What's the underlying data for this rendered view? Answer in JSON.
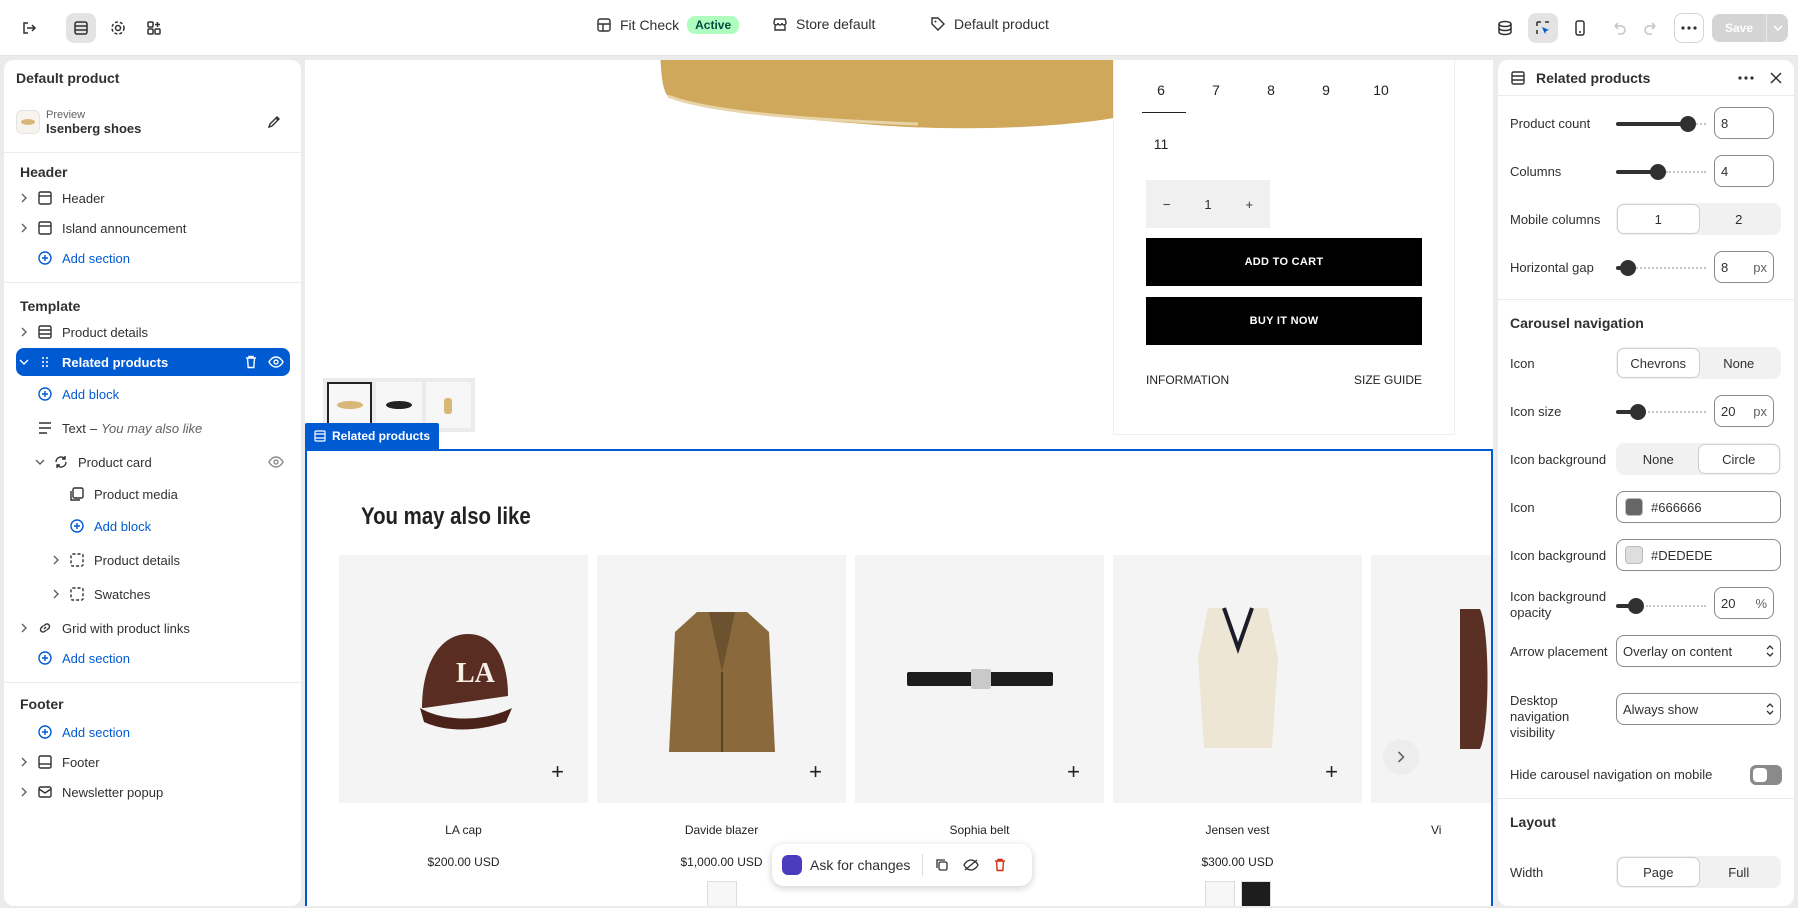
{
  "topbar": {
    "theme_name": "Fit Check",
    "theme_status": "Active",
    "store": "Store default",
    "template": "Default product",
    "save_label": "Save"
  },
  "sidebar": {
    "title": "Default product",
    "preview_label": "Preview",
    "preview_value": "Isenberg shoes",
    "header_group": "Header",
    "header_items": [
      "Header",
      "Island announcement"
    ],
    "add_section": "Add section",
    "template_group": "Template",
    "product_details": "Product details",
    "related_products": "Related products",
    "add_block": "Add block",
    "text_block": "Text",
    "text_block_sep": "–",
    "text_block_value": "You may also like",
    "product_card": "Product card",
    "product_media": "Product media",
    "card_product_details": "Product details",
    "swatches": "Swatches",
    "grid_links": "Grid with product links",
    "footer_group": "Footer",
    "footer": "Footer",
    "newsletter": "Newsletter popup"
  },
  "canvas": {
    "sizes": [
      "6",
      "7",
      "8",
      "9",
      "10",
      "11"
    ],
    "quantity": "1",
    "qty_minus": "−",
    "qty_plus": "+",
    "add_to_cart": "ADD TO CART",
    "buy_now": "BUY IT NOW",
    "information": "INFORMATION",
    "size_guide": "SIZE GUIDE",
    "section_tag": "Related products",
    "heading": "You may also like",
    "card_plus": "+",
    "products": [
      {
        "name": "LA cap",
        "price": "$200.00 USD"
      },
      {
        "name": "Davide blazer",
        "price": "$1,000.00 USD"
      },
      {
        "name": "Sophia belt",
        "price": ""
      },
      {
        "name": "Jensen vest",
        "price": "$300.00 USD"
      },
      {
        "name": "Vi",
        "price": ""
      }
    ],
    "ask_label": "Ask for changes"
  },
  "panel": {
    "title": "Related products",
    "product_count_label": "Product count",
    "product_count": "8",
    "columns_label": "Columns",
    "columns": "4",
    "mobile_columns_label": "Mobile columns",
    "mobile_columns_options": [
      "1",
      "2"
    ],
    "horizontal_gap_label": "Horizontal gap",
    "horizontal_gap": "8",
    "unit_px": "px",
    "carousel_title": "Carousel navigation",
    "icon_label": "Icon",
    "icon_options": [
      "Chevrons",
      "None"
    ],
    "icon_size_label": "Icon size",
    "icon_size": "20",
    "icon_bg_label": "Icon background",
    "icon_bg_options": [
      "None",
      "Circle"
    ],
    "icon_color_label": "Icon",
    "icon_color": "#666666",
    "icon_bg_color_label": "Icon background",
    "icon_bg_color": "#DEDEDE",
    "icon_bg_opacity_label": "Icon background opacity",
    "icon_bg_opacity": "20",
    "unit_pct": "%",
    "arrow_placement_label": "Arrow placement",
    "arrow_placement": "Overlay on content",
    "desktop_nav_label": "Desktop navigation visibility",
    "desktop_nav": "Always show",
    "hide_mobile_label": "Hide carousel navigation on mobile",
    "layout_title": "Layout",
    "width_label": "Width",
    "width_options": [
      "Page",
      "Full"
    ]
  },
  "colors": {
    "accent": "#005bd3",
    "active_badge_bg": "#affebf",
    "icon_chip": "#666666",
    "icon_bg_chip": "#DEDEDE"
  }
}
